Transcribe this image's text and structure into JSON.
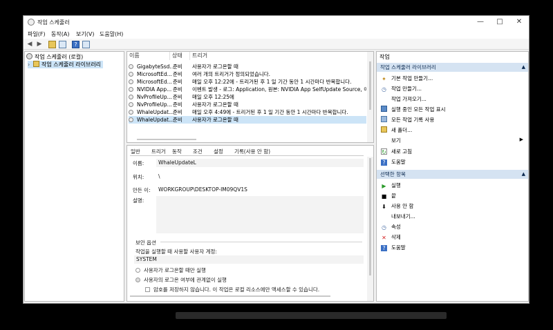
{
  "window": {
    "title": "작업 스케줄러",
    "minimize": "—",
    "maximize": "□",
    "close": "✕"
  },
  "menu": [
    "파일(F)",
    "동작(A)",
    "보기(V)",
    "도움말(H)"
  ],
  "toolbar": {
    "back_icon": "arrow-left-icon",
    "forward_icon": "arrow-right-icon"
  },
  "tree": {
    "root": "작업 스케줄러 (로컬)",
    "child": "작업 스케줄러 라이브러리"
  },
  "task_list": {
    "columns": [
      "이름",
      "상태",
      "트리거"
    ],
    "rows": [
      {
        "name": "GigabyteSsd...",
        "status": "준비",
        "trigger": "사용자가 로그온할 때"
      },
      {
        "name": "MicrosoftEd...",
        "status": "준비",
        "trigger": "여러 개의 트리거가 정의되었습니다."
      },
      {
        "name": "MicrosoftEd...",
        "status": "준비",
        "trigger": "매일 오후 12:22에 - 트리거된 후 1 일 기간 동안 1 시간마다 반복합니다."
      },
      {
        "name": "NVIDIA App...",
        "status": "준비",
        "trigger": "이벤트 발생 - 로그: Application, 원본: NVIDIA App SelfUpdate Source, 이벤트"
      },
      {
        "name": "NvProfileUp...",
        "status": "준비",
        "trigger": "매일 오후 12:25에"
      },
      {
        "name": "NvProfileUp...",
        "status": "준비",
        "trigger": "사용자가 로그온할 때"
      },
      {
        "name": "WhaleUpdat...",
        "status": "준비",
        "trigger": "매일 오후 4:49에 - 트리거된 후 1 일 기간 동안 1 시간마다 반복합니다."
      },
      {
        "name": "WhaleUpdat...",
        "status": "준비",
        "trigger": "사용자가 로그온할 때"
      }
    ]
  },
  "detail": {
    "tabs": [
      "일반",
      "트리거",
      "동작",
      "조건",
      "설정",
      "기록(사용 안 함)"
    ],
    "name_label": "이름:",
    "name_value": "WhaleUpdateL",
    "location_label": "위치:",
    "location_value": "\\",
    "author_label": "만든 이:",
    "author_value": "WORKGROUP\\DESKTOP-IM09QV1S",
    "description_label": "설명:",
    "description_value": "",
    "security_title": "보안 옵션",
    "run_as_label": "작업을 실행할 때 사용할 사용자 계정:",
    "run_as_value": "SYSTEM",
    "radio1": "사용자가 로그온할 때만 실행",
    "radio2": "사용자의 로그온 여부에 관계없이 실행",
    "checkbox": "암호를 저장하지 않습니다. 이 작업은 로컬 리소스에만 액세스할 수 있습니다."
  },
  "actions": {
    "header": "작업",
    "section1": "작업 스케줄러 라이브러리",
    "items1": [
      {
        "label": "기본 작업 만들기...",
        "icon": "wizard-icon"
      },
      {
        "label": "작업 만들기...",
        "icon": "task-create-icon"
      },
      {
        "label": "작업 가져오기...",
        "icon": "import-icon"
      },
      {
        "label": "실행 중인 모든 작업 표시",
        "icon": "running-tasks-icon"
      },
      {
        "label": "모든 작업 기록 사용",
        "icon": "history-icon"
      },
      {
        "label": "새 폴더...",
        "icon": "new-folder-icon"
      },
      {
        "label": "보기",
        "icon": "view-icon"
      },
      {
        "label": "새로 고침",
        "icon": "refresh-icon"
      },
      {
        "label": "도움말",
        "icon": "help-icon"
      }
    ],
    "section2": "선택한 항목",
    "items2": [
      {
        "label": "실행",
        "icon": "run-icon"
      },
      {
        "label": "끝",
        "icon": "end-icon"
      },
      {
        "label": "사용 안 함",
        "icon": "disable-icon"
      },
      {
        "label": "내보내기...",
        "icon": "export-icon"
      },
      {
        "label": "속성",
        "icon": "properties-icon"
      },
      {
        "label": "삭제",
        "icon": "delete-icon"
      },
      {
        "label": "도움말",
        "icon": "help-icon"
      }
    ]
  },
  "colors": {
    "selection": "#cce4f7",
    "action_header": "#d5e3f2",
    "delete": "#d42020",
    "run": "#2a9a2a"
  }
}
